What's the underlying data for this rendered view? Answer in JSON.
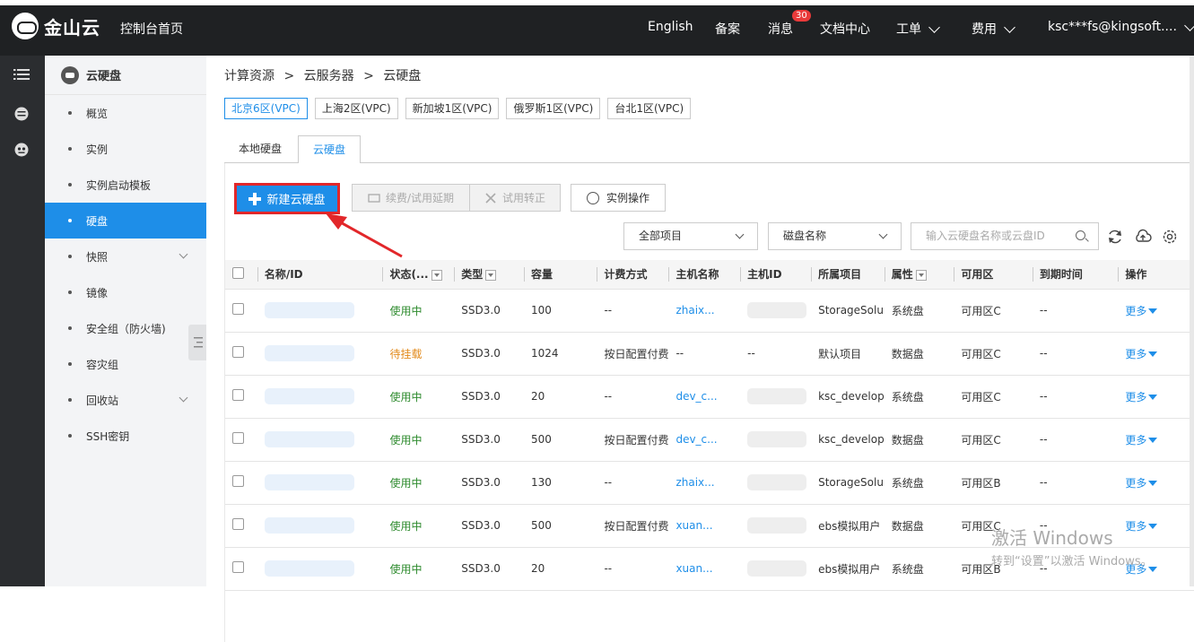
{
  "topbar": {
    "brand": "金山云",
    "home": "控制台首页",
    "nav": {
      "english": "English",
      "beian": "备案",
      "messages": "消息",
      "messages_badge": "30",
      "docs": "文档中心",
      "tickets": "工单",
      "billing": "费用",
      "account": "ksc***fs@kingsoft...."
    }
  },
  "sidebar": {
    "title": "云硬盘",
    "items": [
      {
        "label": "概览"
      },
      {
        "label": "实例"
      },
      {
        "label": "实例启动模板"
      },
      {
        "label": "硬盘"
      },
      {
        "label": "快照"
      },
      {
        "label": "镜像"
      },
      {
        "label": "安全组（防火墙)"
      },
      {
        "label": "容灾组"
      },
      {
        "label": "回收站"
      },
      {
        "label": "SSH密钥"
      }
    ]
  },
  "breadcrumb": {
    "a": "计算资源",
    "b": "云服务器",
    "c": "云硬盘",
    "sep": ">"
  },
  "regions": [
    "北京6区(VPC)",
    "上海2区(VPC)",
    "新加坡1区(VPC)",
    "俄罗斯1区(VPC)",
    "台北1区(VPC)"
  ],
  "tabs": {
    "local": "本地硬盘",
    "cloud": "云硬盘"
  },
  "toolbar": {
    "new": "新建云硬盘",
    "renew": "续费/试用延期",
    "trial": "试用转正",
    "ops": "实例操作"
  },
  "filters": {
    "project": "全部项目",
    "field": "磁盘名称",
    "search_placeholder": "输入云硬盘名称或云盘ID"
  },
  "table": {
    "headers": {
      "name": "名称/ID",
      "status": "状态(...",
      "type": "类型",
      "size": "容量",
      "billing": "计费方式",
      "host": "主机名称",
      "hostid": "主机ID",
      "project": "所属项目",
      "attr": "属性",
      "zone": "可用区",
      "expire": "到期时间",
      "op": "操作"
    },
    "rows": [
      {
        "status": "使用中",
        "status_kind": "on",
        "type": "SSD3.0",
        "size": "100",
        "billing": "--",
        "host": "zhaix...",
        "hostid": "",
        "project": "StorageSolu",
        "attr": "系统盘",
        "zone": "可用区C",
        "expire": "--",
        "op": "更多"
      },
      {
        "status": "待挂载",
        "status_kind": "wait",
        "type": "SSD3.0",
        "size": "1024",
        "billing": "按日配置付费",
        "host": "--",
        "hostid": "--",
        "project": "默认项目",
        "attr": "数据盘",
        "zone": "可用区C",
        "expire": "--",
        "op": "更多"
      },
      {
        "status": "使用中",
        "status_kind": "on",
        "type": "SSD3.0",
        "size": "20",
        "billing": "--",
        "host": "dev_c...",
        "hostid": "",
        "project": "ksc_develop",
        "attr": "系统盘",
        "zone": "可用区C",
        "expire": "--",
        "op": "更多"
      },
      {
        "status": "使用中",
        "status_kind": "on",
        "type": "SSD3.0",
        "size": "500",
        "billing": "按日配置付费",
        "host": "dev_c...",
        "hostid": "",
        "project": "ksc_develop",
        "attr": "数据盘",
        "zone": "可用区C",
        "expire": "--",
        "op": "更多"
      },
      {
        "status": "使用中",
        "status_kind": "on",
        "type": "SSD3.0",
        "size": "130",
        "billing": "--",
        "host": "zhaix...",
        "hostid": "",
        "project": "StorageSolu",
        "attr": "系统盘",
        "zone": "可用区B",
        "expire": "--",
        "op": "更多"
      },
      {
        "status": "使用中",
        "status_kind": "on",
        "type": "SSD3.0",
        "size": "500",
        "billing": "按日配置付费",
        "host": "xuan...",
        "hostid": "",
        "project": "ebs模拟用户",
        "attr": "数据盘",
        "zone": "可用区C",
        "expire": "--",
        "op": "更多"
      },
      {
        "status": "使用中",
        "status_kind": "on",
        "type": "SSD3.0",
        "size": "20",
        "billing": "--",
        "host": "xuan...",
        "hostid": "",
        "project": "ebs模拟用户",
        "attr": "系统盘",
        "zone": "可用区B",
        "expire": "--",
        "op": "更多"
      }
    ]
  },
  "watermark": {
    "line1": "激活 Windows",
    "line2": "转到“设置”以激活 Windows。"
  },
  "colors": {
    "accent": "#1e8ee8",
    "topbar": "#1f2123",
    "highlight": "#e2272a"
  }
}
